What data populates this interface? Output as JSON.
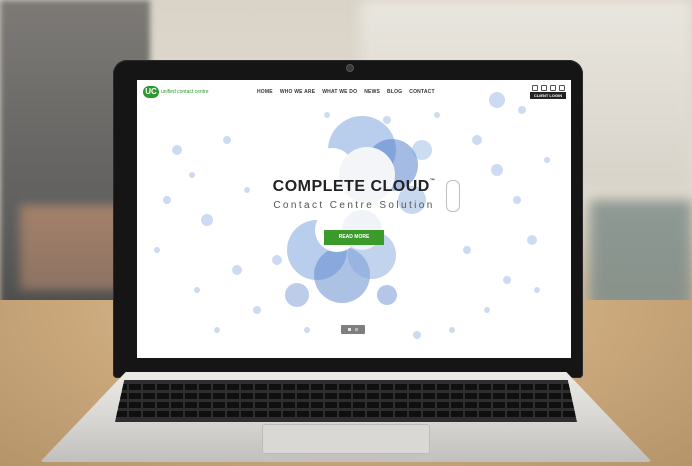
{
  "website": {
    "logo": {
      "mark": "UC",
      "text": "unified contact centre"
    },
    "nav": {
      "items": [
        {
          "label": "HOME"
        },
        {
          "label": "WHO WE ARE"
        },
        {
          "label": "WHAT WE DO"
        },
        {
          "label": "NEWS"
        },
        {
          "label": "BLOG"
        },
        {
          "label": "CONTACT"
        }
      ],
      "client_login": "CLIENT LOGIN"
    },
    "hero": {
      "title": "COMPLETE CLOUD",
      "trademark": "™",
      "subtitle": "Contact Centre Solution",
      "cta": "READ MORE"
    }
  },
  "colors": {
    "brand_green": "#2d9a2e",
    "button_green": "#3a9b2a",
    "cloud_blue": "#4a7fd0"
  },
  "icons": [
    "search-icon",
    "mail-icon",
    "twitter-icon",
    "linkedin-icon"
  ]
}
